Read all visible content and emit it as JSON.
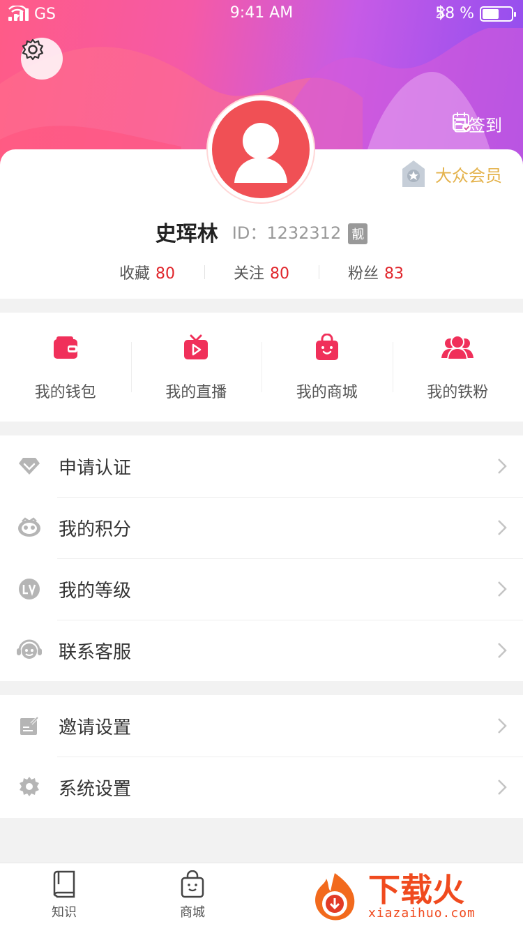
{
  "status_bar": {
    "carrier": "GS",
    "time": "9:41 AM",
    "battery": "58 %",
    "battery_level": 0.58
  },
  "header": {
    "signed_in_label": "已签到",
    "member_label": "大众会员"
  },
  "profile": {
    "name": "史珲林",
    "id_label": "ID：1232312",
    "tag": "靓",
    "stats": [
      {
        "label": "收藏",
        "value": "80"
      },
      {
        "label": "关注",
        "value": "80"
      },
      {
        "label": "粉丝",
        "value": "83"
      }
    ]
  },
  "quick_actions": [
    {
      "label": "我的钱包",
      "icon": "wallet-icon"
    },
    {
      "label": "我的直播",
      "icon": "tv-play-icon"
    },
    {
      "label": "我的商城",
      "icon": "shopping-bag-icon"
    },
    {
      "label": "我的铁粉",
      "icon": "fans-icon"
    }
  ],
  "menu_group_1": [
    {
      "label": "申请认证",
      "icon": "diamond-icon"
    },
    {
      "label": "我的积分",
      "icon": "points-icon"
    },
    {
      "label": "我的等级",
      "icon": "level-icon"
    },
    {
      "label": "联系客服",
      "icon": "headset-icon"
    }
  ],
  "menu_group_2": [
    {
      "label": "邀请设置",
      "icon": "invite-edit-icon"
    },
    {
      "label": "系统设置",
      "icon": "gear-icon"
    }
  ],
  "tabs": [
    {
      "label": "知识",
      "icon": "book-icon"
    },
    {
      "label": "商城",
      "icon": "bag-icon"
    }
  ],
  "watermark": {
    "brand": "下载火",
    "url": "xiazaihuo.com"
  },
  "colors": {
    "accent": "#f0305a",
    "price_red": "#e0242a",
    "gold": "#e4b24b",
    "avatar_red": "#f05055"
  }
}
